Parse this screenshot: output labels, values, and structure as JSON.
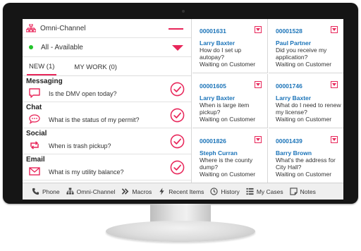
{
  "colors": {
    "accent": "#e8265a",
    "link": "#1a73b8",
    "available": "#22c32a"
  },
  "channel_selector": {
    "label": "Omni-Channel",
    "icon": "sitemap-icon"
  },
  "status_selector": {
    "label": "All - Available"
  },
  "tabs": [
    {
      "label": "NEW (1)",
      "active": true
    },
    {
      "label": "MY WORK (0)",
      "active": false
    }
  ],
  "work_items": [
    {
      "channel": "Messaging",
      "question": "Is the DMV open today?",
      "icon": "chat-bubble-icon"
    },
    {
      "channel": "Chat",
      "question": "What is the status of my permit?",
      "icon": "chat-dots-icon"
    },
    {
      "channel": "Social",
      "question": "When is trash pickup?",
      "icon": "retweet-icon"
    },
    {
      "channel": "Email",
      "question": "What is my utility balance?",
      "icon": "envelope-icon"
    }
  ],
  "tickets": [
    {
      "number": "00001631",
      "name": "Larry Baxter",
      "message": "How do I set up autopay?",
      "status": "Waiting on Customer"
    },
    {
      "number": "00001528",
      "name": "Paul Partner",
      "message": "Did you receive my application?",
      "status": "Waiting on Customer"
    },
    {
      "number": "00001605",
      "name": "Larry Baxter",
      "message": "When is large item pickup?",
      "status": "Waiting on Customer"
    },
    {
      "number": "00001746",
      "name": "Larry Baxter",
      "message": "What do I need to renew my license?",
      "status": "Waiting on Customer"
    },
    {
      "number": "00001826",
      "name": "Steph Curran",
      "message": "Where is the county dump?",
      "status": "Waiting on Customer"
    },
    {
      "number": "00001439",
      "name": "Barry Brown",
      "message": "What's the address for City Hall?",
      "status": "Waiting on Customer"
    }
  ],
  "toolbar": [
    {
      "label": "Phone",
      "icon": "phone-icon"
    },
    {
      "label": "Omni-Channel",
      "icon": "sitemap-icon"
    },
    {
      "label": "Macros",
      "icon": "chevrons-right-icon"
    },
    {
      "label": "Recent Items",
      "icon": "lightning-icon"
    },
    {
      "label": "History",
      "icon": "clock-icon"
    },
    {
      "label": "My Cases",
      "icon": "list-icon"
    },
    {
      "label": "Notes",
      "icon": "note-icon"
    }
  ]
}
